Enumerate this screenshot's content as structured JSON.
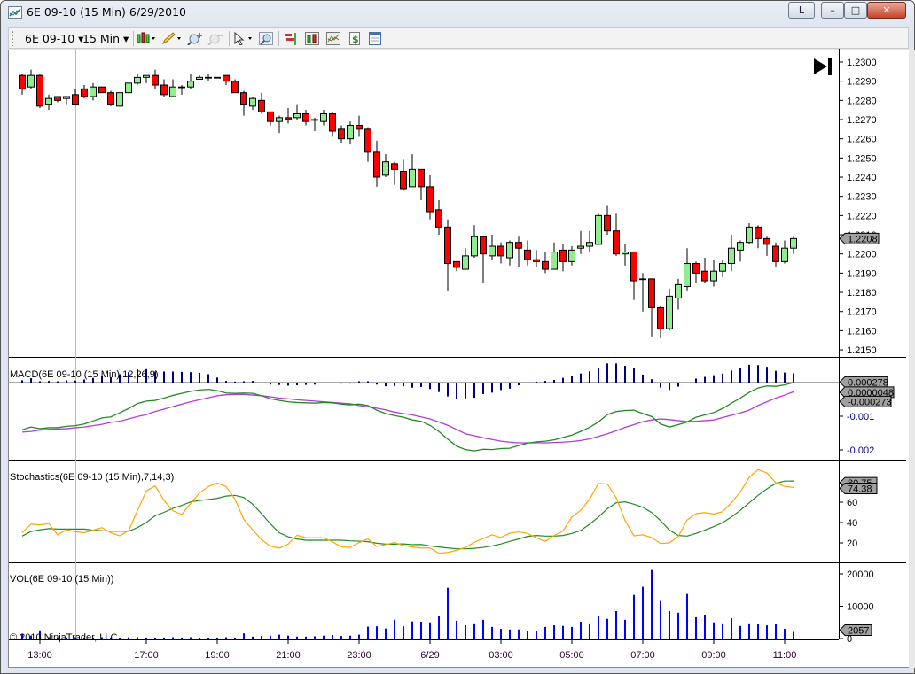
{
  "window": {
    "title": "6E 09-10 (15 Min)  6/29/2010",
    "buttons": {
      "link": "L",
      "minimize": "–",
      "maximize": "□",
      "close": "✕"
    }
  },
  "toolbar": {
    "instrument": "6E 09-10",
    "interval": "15 Min",
    "dropdown_glyph": "▾",
    "icons": [
      "chart-style-icon",
      "pencil-drawing-icon",
      "zoom-in-icon",
      "zoom-out-icon",
      "cursor-pointer-icon",
      "magnifier-icon",
      "data-box-icon",
      "bar-chart-icon",
      "indicators-icon",
      "strategies-dollar-icon",
      "properties-icon"
    ]
  },
  "colors": {
    "up": "#90ee90",
    "down": "#ff0000",
    "macd": "#228b22",
    "avg": "#b23cd8",
    "diff": "#000080",
    "stoch_k": "#ffa500",
    "stoch_d": "#228b22",
    "volume": "#0000ff"
  },
  "copyright": "© 2010 NinjaTrader, LLC",
  "end_of_chart_icon": "skip-to-end-icon",
  "chart_data": [
    {
      "type": "candlestick",
      "title": "",
      "ylim": [
        1.2145,
        1.2305
      ],
      "y_ticks": [
        "1.2300",
        "1.2290",
        "1.2280",
        "1.2270",
        "1.2260",
        "1.2250",
        "1.2240",
        "1.2230",
        "1.2220",
        "1.2210",
        "1.2200",
        "1.2190",
        "1.2180",
        "1.2170",
        "1.2160",
        "1.2150"
      ],
      "last_price_label": "1.2208",
      "x_ticks": [
        {
          "label": "13:00",
          "bar": 2
        },
        {
          "label": "17:00",
          "bar": 14
        },
        {
          "label": "19:00",
          "bar": 22
        },
        {
          "label": "21:00",
          "bar": 30
        },
        {
          "label": "23:00",
          "bar": 38
        },
        {
          "label": "6/29",
          "bar": 46
        },
        {
          "label": "03:00",
          "bar": 54
        },
        {
          "label": "05:00",
          "bar": 62
        },
        {
          "label": "07:00",
          "bar": 70
        },
        {
          "label": "09:00",
          "bar": 78
        },
        {
          "label": "11:00",
          "bar": 86
        }
      ],
      "ohlc_fields": [
        "open",
        "high",
        "low",
        "close"
      ],
      "ohlc": [
        [
          1.2293,
          1.2294,
          1.2283,
          1.2286
        ],
        [
          1.2287,
          1.2296,
          1.2286,
          1.2293
        ],
        [
          1.2293,
          1.2294,
          1.2276,
          1.2277
        ],
        [
          1.2278,
          1.2283,
          1.2275,
          1.2281
        ],
        [
          1.2282,
          1.2282,
          1.2279,
          1.228
        ],
        [
          1.2281,
          1.2282,
          1.2278,
          1.2282
        ],
        [
          1.2283,
          1.2286,
          1.2278,
          1.2278
        ],
        [
          1.2286,
          1.2288,
          1.2281,
          1.2282
        ],
        [
          1.2282,
          1.2289,
          1.228,
          1.2287
        ],
        [
          1.2287,
          1.2287,
          1.2284,
          1.2284
        ],
        [
          1.2284,
          1.2285,
          1.2277,
          1.2278
        ],
        [
          1.2277,
          1.2284,
          1.2277,
          1.2284
        ],
        [
          1.2284,
          1.2289,
          1.2284,
          1.2289
        ],
        [
          1.2289,
          1.2294,
          1.2288,
          1.2292
        ],
        [
          1.2292,
          1.2293,
          1.2289,
          1.2293
        ],
        [
          1.2293,
          1.2296,
          1.2286,
          1.2288
        ],
        [
          1.2288,
          1.2291,
          1.2282,
          1.2283
        ],
        [
          1.2282,
          1.2291,
          1.2282,
          1.2287
        ],
        [
          1.2287,
          1.2288,
          1.2283,
          1.2287
        ],
        [
          1.2287,
          1.2294,
          1.2286,
          1.229
        ],
        [
          1.2291,
          1.2293,
          1.2291,
          1.2292
        ],
        [
          1.2292,
          1.2294,
          1.229,
          1.2292
        ],
        [
          1.2292,
          1.2292,
          1.2292,
          1.2292
        ],
        [
          1.2293,
          1.2293,
          1.2288,
          1.229
        ],
        [
          1.229,
          1.2291,
          1.2284,
          1.2284
        ],
        [
          1.2284,
          1.2285,
          1.2272,
          1.2278
        ],
        [
          1.2277,
          1.2282,
          1.2275,
          1.2281
        ],
        [
          1.228,
          1.2284,
          1.2273,
          1.2274
        ],
        [
          1.2274,
          1.2274,
          1.2267,
          1.2269
        ],
        [
          1.2269,
          1.2272,
          1.2263,
          1.2271
        ],
        [
          1.2271,
          1.2276,
          1.2268,
          1.227
        ],
        [
          1.2271,
          1.2278,
          1.227,
          1.2273
        ],
        [
          1.2273,
          1.2275,
          1.2267,
          1.2269
        ],
        [
          1.227,
          1.2271,
          1.2264,
          1.227
        ],
        [
          1.2269,
          1.2275,
          1.2267,
          1.2273
        ],
        [
          1.2273,
          1.2274,
          1.2261,
          1.2264
        ],
        [
          1.2265,
          1.2267,
          1.2258,
          1.226
        ],
        [
          1.226,
          1.2269,
          1.2257,
          1.2267
        ],
        [
          1.2267,
          1.2272,
          1.2261,
          1.2265
        ],
        [
          1.2265,
          1.2266,
          1.2248,
          1.2253
        ],
        [
          1.2253,
          1.2259,
          1.2235,
          1.224
        ],
        [
          1.2241,
          1.2252,
          1.224,
          1.2248
        ],
        [
          1.2247,
          1.2248,
          1.2236,
          1.2244
        ],
        [
          1.2243,
          1.2249,
          1.2233,
          1.2234
        ],
        [
          1.2235,
          1.2252,
          1.2235,
          1.2244
        ],
        [
          1.2244,
          1.2244,
          1.2228,
          1.2235
        ],
        [
          1.2235,
          1.2241,
          1.2218,
          1.2222
        ],
        [
          1.2223,
          1.2228,
          1.221,
          1.2214
        ],
        [
          1.2214,
          1.2218,
          1.2181,
          1.2195
        ],
        [
          1.2196,
          1.2196,
          1.2191,
          1.2193
        ],
        [
          1.2192,
          1.2203,
          1.2192,
          1.2199
        ],
        [
          1.2199,
          1.2215,
          1.2198,
          1.2209
        ],
        [
          1.2209,
          1.2209,
          1.2185,
          1.22
        ],
        [
          1.2199,
          1.221,
          1.2197,
          1.2204
        ],
        [
          1.2204,
          1.2206,
          1.2195,
          1.2199
        ],
        [
          1.2198,
          1.2207,
          1.2194,
          1.2206
        ],
        [
          1.2206,
          1.2209,
          1.2193,
          1.2203
        ],
        [
          1.2202,
          1.2207,
          1.2194,
          1.2197
        ],
        [
          1.2197,
          1.2202,
          1.2193,
          1.2196
        ],
        [
          1.2196,
          1.2201,
          1.219,
          1.2192
        ],
        [
          1.2192,
          1.2206,
          1.2192,
          1.2201
        ],
        [
          1.2202,
          1.2205,
          1.2191,
          1.2196
        ],
        [
          1.2196,
          1.2204,
          1.2194,
          1.2202
        ],
        [
          1.2203,
          1.2212,
          1.22,
          1.2204
        ],
        [
          1.2204,
          1.2212,
          1.2201,
          1.2206
        ],
        [
          1.2205,
          1.2221,
          1.2205,
          1.222
        ],
        [
          1.222,
          1.2225,
          1.221,
          1.2212
        ],
        [
          1.2212,
          1.2221,
          1.2199,
          1.22
        ],
        [
          1.22,
          1.2205,
          1.2194,
          1.2201
        ],
        [
          1.2201,
          1.2201,
          1.2176,
          1.2186
        ],
        [
          1.2187,
          1.219,
          1.217,
          1.2187
        ],
        [
          1.2187,
          1.2187,
          1.2157,
          1.2172
        ],
        [
          1.2172,
          1.2173,
          1.2156,
          1.2161
        ],
        [
          1.2161,
          1.2182,
          1.216,
          1.2178
        ],
        [
          1.2177,
          1.2187,
          1.2171,
          1.2184
        ],
        [
          1.2183,
          1.2203,
          1.2181,
          1.2195
        ],
        [
          1.2195,
          1.2196,
          1.2185,
          1.219
        ],
        [
          1.2191,
          1.2198,
          1.2185,
          1.2186
        ],
        [
          1.2186,
          1.2197,
          1.2183,
          1.2191
        ],
        [
          1.2191,
          1.2197,
          1.2188,
          1.2195
        ],
        [
          1.2195,
          1.221,
          1.2191,
          1.2203
        ],
        [
          1.2202,
          1.2207,
          1.2196,
          1.2206
        ],
        [
          1.2206,
          1.2216,
          1.2205,
          1.2214
        ],
        [
          1.2214,
          1.2215,
          1.2203,
          1.2208
        ],
        [
          1.2208,
          1.2209,
          1.2199,
          1.2205
        ],
        [
          1.2204,
          1.2206,
          1.2193,
          1.2196
        ],
        [
          1.2196,
          1.2207,
          1.2195,
          1.2203
        ],
        [
          1.2203,
          1.2209,
          1.22,
          1.2208
        ]
      ]
    },
    {
      "type": "line",
      "title": "MACD(6E 09-10 (15 Min),12,26,9)",
      "ylim": [
        -0.00229,
        0.00071
      ],
      "y_ticks": [
        "-0.001",
        "-0.002"
      ],
      "value_labels": {
        "diff": "0.000278",
        "macd": "0.0000048",
        "avg": "-0.000273"
      },
      "series": [
        {
          "key": "macd",
          "values": [
            -0.0014,
            -0.00132,
            -0.00137,
            -0.00134,
            -0.00134,
            -0.0013,
            -0.00128,
            -0.00123,
            -0.00114,
            -0.00105,
            -0.00102,
            -0.0009,
            -0.00077,
            -0.00062,
            -0.00055,
            -0.00053,
            -0.00046,
            -0.00038,
            -0.00032,
            -0.00026,
            -0.00022,
            -0.0002,
            -0.00024,
            -0.00031,
            -0.00032,
            -0.00031,
            -0.00032,
            -0.00039,
            -0.00048,
            -0.00053,
            -0.00057,
            -0.00059,
            -0.0006,
            -0.00061,
            -0.00059,
            -0.0006,
            -0.00064,
            -0.00066,
            -0.00064,
            -0.00068,
            -0.00082,
            -0.00092,
            -0.00098,
            -0.00103,
            -0.00111,
            -0.00115,
            -0.00127,
            -0.00145,
            -0.00168,
            -0.00189,
            -0.00199,
            -0.00203,
            -0.00198,
            -0.00199,
            -0.00196,
            -0.00195,
            -0.00187,
            -0.0018,
            -0.00176,
            -0.00174,
            -0.0017,
            -0.00163,
            -0.00156,
            -0.00145,
            -0.00133,
            -0.00117,
            -0.00095,
            -0.00086,
            -0.00083,
            -0.00082,
            -0.00092,
            -0.00101,
            -0.00123,
            -0.00132,
            -0.00125,
            -0.00117,
            -0.00103,
            -0.00096,
            -0.00089,
            -0.00077,
            -0.00061,
            -0.00046,
            -0.00029,
            -0.00016,
            -0.0001,
            -0.00011,
            -7e-05,
            4.8e-06
          ]
        },
        {
          "key": "avg",
          "values": [
            -0.00147,
            -0.00145,
            -0.00141,
            -0.00139,
            -0.00138,
            -0.00137,
            -0.00134,
            -0.00132,
            -0.00128,
            -0.00124,
            -0.00118,
            -0.00115,
            -0.00108,
            -0.00101,
            -0.00095,
            -0.00086,
            -0.00079,
            -0.00071,
            -0.00064,
            -0.00057,
            -0.00051,
            -0.00045,
            -0.00039,
            -0.00036,
            -0.00035,
            -0.00035,
            -0.00037,
            -0.00039,
            -0.00042,
            -0.00046,
            -0.00048,
            -0.00051,
            -0.00053,
            -0.00055,
            -0.00057,
            -0.00059,
            -0.00061,
            -0.00063,
            -0.00068,
            -0.00072,
            -0.00076,
            -0.00081,
            -0.00088,
            -0.00092,
            -0.00096,
            -0.00102,
            -0.00108,
            -0.00117,
            -0.00127,
            -0.00139,
            -0.00152,
            -0.00158,
            -0.00164,
            -0.00169,
            -0.00174,
            -0.00177,
            -0.00179,
            -0.00179,
            -0.00179,
            -0.00179,
            -0.00178,
            -0.00177,
            -0.00175,
            -0.00172,
            -0.00167,
            -0.0016,
            -0.00152,
            -0.00143,
            -0.00133,
            -0.00125,
            -0.00116,
            -0.00111,
            -0.00108,
            -0.0011,
            -0.00113,
            -0.00116,
            -0.00115,
            -0.00113,
            -0.00111,
            -0.00104,
            -0.00097,
            -0.0009,
            -0.00082,
            -0.00068,
            -0.00057,
            -0.00046,
            -0.00037,
            -0.000273
          ]
        }
      ]
    },
    {
      "type": "line",
      "title": "Stochastics(6E 09-10 (15 Min),7,14,3)",
      "ylim": [
        0,
        100
      ],
      "y_ticks": [
        "20",
        "40",
        "60"
      ],
      "value_labels": {
        "d": "80.75",
        "k": "74.38"
      },
      "series": [
        {
          "key": "k",
          "values": [
            30,
            38.5,
            37.7,
            39,
            28,
            33,
            31,
            30,
            32.5,
            35,
            30,
            27,
            32,
            51.6,
            71,
            76,
            61.7,
            51.6,
            47.8,
            58.8,
            69,
            75.4,
            78.8,
            75.4,
            63,
            43,
            32.8,
            23.2,
            16.8,
            14.8,
            18.8,
            27.5,
            25,
            25,
            25,
            21,
            16,
            15.7,
            20.3,
            24,
            16.5,
            18.3,
            20.3,
            17.4,
            16,
            15,
            15,
            9.8,
            10.7,
            12.7,
            15.6,
            20.6,
            24.4,
            27.9,
            25.3,
            29.6,
            30.8,
            29.3,
            25,
            21.5,
            27.3,
            31.7,
            45.4,
            52,
            62.9,
            78.4,
            77.8,
            64.4,
            41.9,
            27,
            27.9,
            25.3,
            19.4,
            20,
            26.4,
            42.5,
            48.6,
            49.8,
            48.3,
            50.7,
            59.4,
            70.2,
            84.2,
            92,
            88.6,
            79,
            75.5,
            74.38
          ]
        },
        {
          "key": "d",
          "values": [
            26.7,
            31.3,
            32.8,
            34,
            33.6,
            33.6,
            33.6,
            33.6,
            32.5,
            32,
            31.5,
            31.5,
            31.5,
            35,
            40,
            46.7,
            50,
            54,
            56.8,
            60.3,
            61.7,
            62.6,
            63.8,
            66,
            66.7,
            64.6,
            58,
            48.7,
            38.6,
            30,
            26,
            23.8,
            22.6,
            22.6,
            22.6,
            22.6,
            22.6,
            22,
            21.7,
            21.2,
            19.7,
            18.8,
            18.8,
            19,
            18.3,
            18.5,
            17,
            16,
            15,
            14.2,
            14.2,
            14.7,
            15.6,
            17,
            19,
            21.5,
            23.8,
            26.4,
            27.3,
            26.7,
            26.7,
            27.3,
            29.3,
            32.2,
            38.4,
            45.4,
            53.6,
            59.4,
            60.3,
            58,
            55,
            49.8,
            41.9,
            32.6,
            27.3,
            26.7,
            29.3,
            32.6,
            36,
            39.9,
            45.4,
            52,
            59.4,
            66.7,
            73,
            78.4,
            80.7,
            80.75
          ]
        }
      ]
    },
    {
      "type": "bar",
      "title": "VOL(6E 09-10 (15 Min))",
      "ylim": [
        0,
        23000
      ],
      "y_ticks": [
        "20000",
        "10000",
        "0"
      ],
      "value_label": "2057",
      "values": [
        1400,
        900,
        2500,
        400,
        300,
        300,
        400,
        300,
        300,
        400,
        300,
        300,
        400,
        400,
        300,
        300,
        300,
        400,
        300,
        400,
        300,
        300,
        300,
        400,
        300,
        1600,
        600,
        800,
        900,
        1200,
        900,
        600,
        600,
        700,
        900,
        1100,
        800,
        900,
        1200,
        3700,
        3800,
        3100,
        5800,
        3800,
        5300,
        5200,
        5000,
        6900,
        15700,
        5500,
        4100,
        4700,
        5800,
        3600,
        3000,
        2800,
        2800,
        2200,
        2200,
        3600,
        4100,
        3900,
        3600,
        5200,
        4700,
        6900,
        6100,
        8500,
        5800,
        13500,
        16000,
        21200,
        11600,
        8500,
        8000,
        13800,
        6600,
        7400,
        5000,
        4700,
        6300,
        3900,
        4700,
        4400,
        4100,
        4400,
        3000,
        2057
      ]
    }
  ]
}
